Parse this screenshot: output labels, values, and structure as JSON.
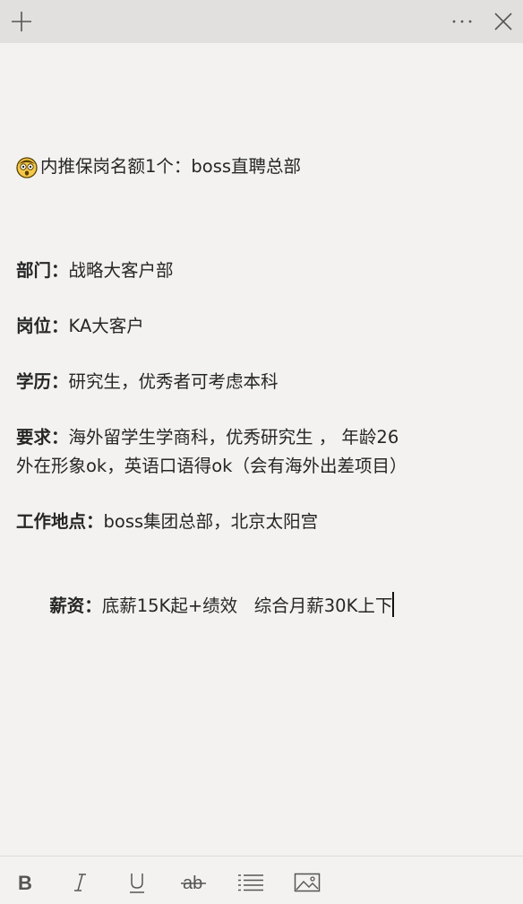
{
  "note": {
    "title": "内推保岗名额1个：boss直聘总部",
    "fields": [
      {
        "label": "部门：",
        "value": "战略大客户部"
      },
      {
        "label": "岗位：",
        "value": "KA大客户"
      },
      {
        "label": "学历：",
        "value": "研究生，优秀者可考虑本科"
      },
      {
        "label": "要求：",
        "value": "海外留学生学商科，优秀研究生 ， 年龄26",
        "continuation": "外在形象ok，英语口语得ok（会有海外出差项目）"
      },
      {
        "label": "工作地点：",
        "value": "boss集团总部，北京太阳宫"
      },
      {
        "label": "薪资：",
        "value": "底薪15K起+绩效   综合月薪30K上下"
      }
    ]
  },
  "titlebar": {
    "icons": [
      "plus-icon",
      "more-icon",
      "close-icon"
    ]
  },
  "toolbar": {
    "icons": [
      "bold-icon",
      "italic-icon",
      "underline-icon",
      "strikethrough-icon",
      "list-icon",
      "image-icon"
    ]
  },
  "colors": {
    "titlebar_bg": "#e1e0df",
    "page_bg": "#f3f2f1",
    "text": "#262626",
    "icon": "#555555"
  }
}
